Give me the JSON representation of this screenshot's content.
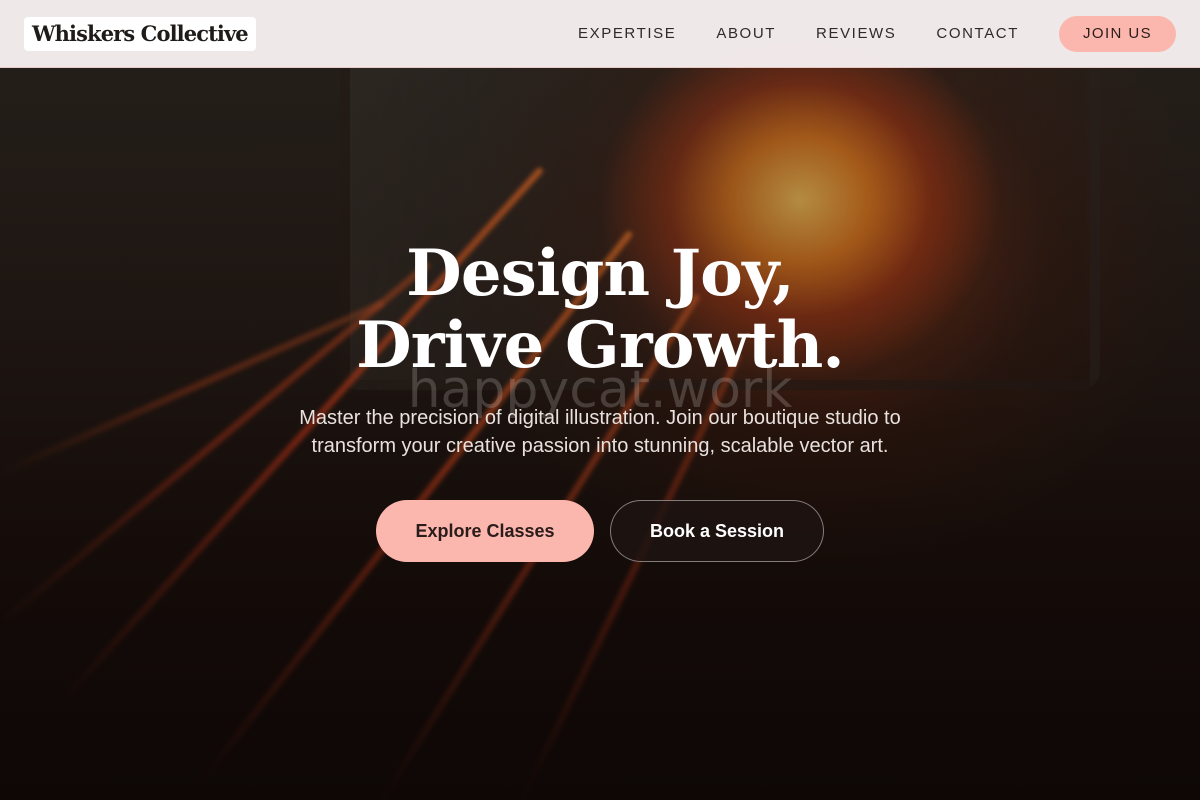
{
  "brand": {
    "name": "Whiskers Collective"
  },
  "nav": {
    "links": [
      "EXPERTISE",
      "ABOUT",
      "REVIEWS",
      "CONTACT"
    ],
    "cta_label": "JOIN US"
  },
  "hero": {
    "headline_line1": "Design Joy,",
    "headline_line2": "Drive Growth.",
    "watermark": "happycat.work",
    "subtitle": "Master the precision of digital illustration. Join our boutique studio to transform your creative passion into stunning, scalable vector art.",
    "primary_cta": "Explore Classes",
    "secondary_cta": "Book a Session"
  },
  "colors": {
    "accent": "#fbb6ae",
    "nav_background": "#f7f0f1",
    "text_dark": "#2f2b2a"
  }
}
